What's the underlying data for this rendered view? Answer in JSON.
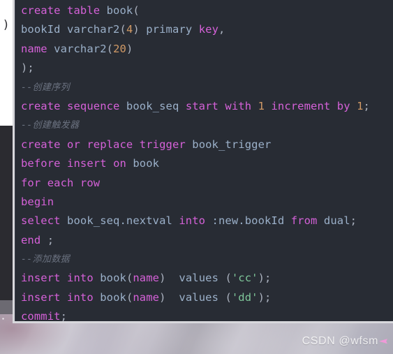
{
  "window": {
    "editor_background": "#282c34",
    "border_color": "#d8d8dc",
    "behind_window_glyph": ")"
  },
  "theme": {
    "keyword": "#d561d8",
    "identifier": "#9bb0c9",
    "number": "#d19a66",
    "string": "#7ec699",
    "comment": "#6b7280",
    "punctuation": "#abb2bf"
  },
  "code": {
    "language": "sql",
    "lines": [
      {
        "n": 1,
        "type": "code",
        "text": "create table book("
      },
      {
        "n": 2,
        "type": "code",
        "text": "bookId varchar2(4) primary key,"
      },
      {
        "n": 3,
        "type": "code",
        "text": "name varchar2(20)"
      },
      {
        "n": 4,
        "type": "code",
        "text": ");"
      },
      {
        "n": 5,
        "type": "comment",
        "text": "--创建序列"
      },
      {
        "n": 6,
        "type": "code",
        "text": "create sequence book_seq start with 1 increment by 1;"
      },
      {
        "n": 7,
        "type": "comment",
        "text": "--创建触发器"
      },
      {
        "n": 8,
        "type": "code",
        "text": "create or replace trigger book_trigger"
      },
      {
        "n": 9,
        "type": "code",
        "text": "before insert on book"
      },
      {
        "n": 10,
        "type": "code",
        "text": "for each row"
      },
      {
        "n": 11,
        "type": "code",
        "text": "begin"
      },
      {
        "n": 12,
        "type": "code",
        "text": "select book_seq.nextval into :new.bookId from dual;"
      },
      {
        "n": 13,
        "type": "code",
        "text": "end ;"
      },
      {
        "n": 14,
        "type": "comment",
        "text": "--添加数据"
      },
      {
        "n": 15,
        "type": "code",
        "text": "insert into book(name)  values ('cc');"
      },
      {
        "n": 16,
        "type": "code",
        "text": "insert into book(name)  values ('dd');"
      },
      {
        "n": 17,
        "type": "code",
        "text": "commit;"
      }
    ],
    "tokens": {
      "l1": [
        [
          "create ",
          "kw"
        ],
        [
          "table ",
          "kw"
        ],
        [
          "book",
          "id"
        ],
        [
          "(",
          "punct"
        ]
      ],
      "l2": [
        [
          "bookId ",
          "id"
        ],
        [
          "varchar2",
          "id"
        ],
        [
          "(",
          "punct"
        ],
        [
          "4",
          "num"
        ],
        [
          ") ",
          "punct"
        ],
        [
          "primary ",
          "id"
        ],
        [
          "key",
          "kw"
        ],
        [
          ",",
          "punct"
        ]
      ],
      "l3": [
        [
          "name ",
          "kw"
        ],
        [
          "varchar2",
          "id"
        ],
        [
          "(",
          "punct"
        ],
        [
          "20",
          "num"
        ],
        [
          ")",
          "punct"
        ]
      ],
      "l4": [
        [
          ");",
          "punct"
        ]
      ],
      "l6": [
        [
          "create ",
          "kw"
        ],
        [
          "sequence ",
          "kw"
        ],
        [
          "book_seq ",
          "id"
        ],
        [
          "start ",
          "kw"
        ],
        [
          "with ",
          "kw"
        ],
        [
          "1 ",
          "num"
        ],
        [
          "increment ",
          "kw"
        ],
        [
          "by ",
          "kw"
        ],
        [
          "1",
          "num"
        ],
        [
          ";",
          "punct"
        ]
      ],
      "l8": [
        [
          "create ",
          "kw"
        ],
        [
          "or ",
          "kw"
        ],
        [
          "replace ",
          "kw"
        ],
        [
          "trigger ",
          "kw"
        ],
        [
          "book_trigger",
          "id"
        ]
      ],
      "l9": [
        [
          "before ",
          "kw"
        ],
        [
          "insert ",
          "kw"
        ],
        [
          "on ",
          "kw"
        ],
        [
          "book",
          "id"
        ]
      ],
      "l10": [
        [
          "for ",
          "kw"
        ],
        [
          "each ",
          "kw"
        ],
        [
          "row",
          "kw"
        ]
      ],
      "l11": [
        [
          "begin",
          "kw"
        ]
      ],
      "l12": [
        [
          "select ",
          "kw"
        ],
        [
          "book_seq.nextval ",
          "id"
        ],
        [
          "into ",
          "kw"
        ],
        [
          ":new.bookId ",
          "id"
        ],
        [
          "from ",
          "kw"
        ],
        [
          "dual",
          "id"
        ],
        [
          ";",
          "punct"
        ]
      ],
      "l13": [
        [
          "end ",
          "kw"
        ],
        [
          ";",
          "punct"
        ]
      ],
      "l15": [
        [
          "insert ",
          "kw"
        ],
        [
          "into ",
          "kw"
        ],
        [
          "book",
          "id"
        ],
        [
          "(",
          "punct"
        ],
        [
          "name",
          "kw"
        ],
        [
          ")  ",
          "punct"
        ],
        [
          "values ",
          "id"
        ],
        [
          "(",
          "punct"
        ],
        [
          "'cc'",
          "str"
        ],
        [
          ")",
          "punct"
        ],
        [
          ";",
          "punct"
        ]
      ],
      "l16": [
        [
          "insert ",
          "kw"
        ],
        [
          "into ",
          "kw"
        ],
        [
          "book",
          "id"
        ],
        [
          "(",
          "punct"
        ],
        [
          "name",
          "kw"
        ],
        [
          ")  ",
          "punct"
        ],
        [
          "values ",
          "id"
        ],
        [
          "(",
          "punct"
        ],
        [
          "'dd'",
          "str"
        ],
        [
          ")",
          "punct"
        ],
        [
          ";",
          "punct"
        ]
      ],
      "l17": [
        [
          "commit",
          "kw"
        ],
        [
          ";",
          "punct"
        ]
      ]
    }
  },
  "watermark": {
    "text": "CSDN @wfsm"
  }
}
